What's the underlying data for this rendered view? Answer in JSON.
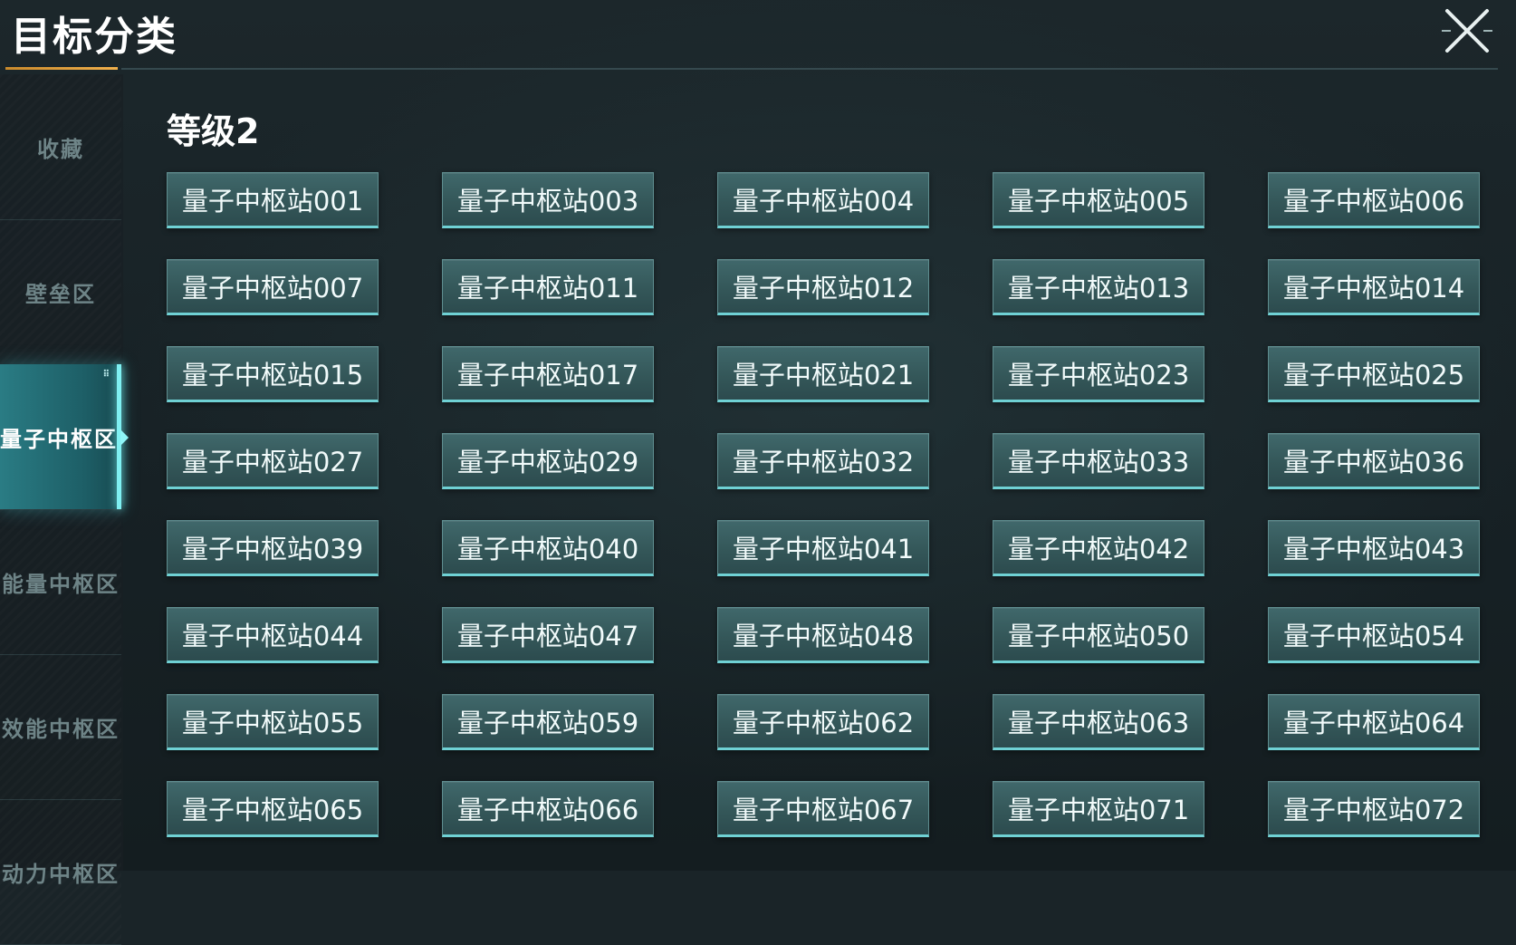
{
  "header": {
    "title": "目标分类",
    "close_icon": "close-x-icon"
  },
  "sidebar": {
    "items": [
      {
        "label": "收藏",
        "active": false
      },
      {
        "label": "壁垒区",
        "active": false
      },
      {
        "label": "量子中枢区",
        "active": true
      },
      {
        "label": "能量中枢区",
        "active": false
      },
      {
        "label": "效能中枢区",
        "active": false
      },
      {
        "label": "动力中枢区",
        "active": false
      }
    ],
    "active_dots": "⠿"
  },
  "main": {
    "section_title": "等级2",
    "items": [
      "量子中枢站001",
      "量子中枢站003",
      "量子中枢站004",
      "量子中枢站005",
      "量子中枢站006",
      "量子中枢站007",
      "量子中枢站011",
      "量子中枢站012",
      "量子中枢站013",
      "量子中枢站014",
      "量子中枢站015",
      "量子中枢站017",
      "量子中枢站021",
      "量子中枢站023",
      "量子中枢站025",
      "量子中枢站027",
      "量子中枢站029",
      "量子中枢站032",
      "量子中枢站033",
      "量子中枢站036",
      "量子中枢站039",
      "量子中枢站040",
      "量子中枢站041",
      "量子中枢站042",
      "量子中枢站043",
      "量子中枢站044",
      "量子中枢站047",
      "量子中枢站048",
      "量子中枢站050",
      "量子中枢站054",
      "量子中枢站055",
      "量子中枢站059",
      "量子中枢站062",
      "量子中枢站063",
      "量子中枢站064",
      "量子中枢站065",
      "量子中枢站066",
      "量子中枢站067",
      "量子中枢站071",
      "量子中枢站072"
    ]
  },
  "colors": {
    "accent_underline": "#e0a040",
    "active_tab": "#2a7c84",
    "button_bottom_glow": "#6fd1d4"
  }
}
